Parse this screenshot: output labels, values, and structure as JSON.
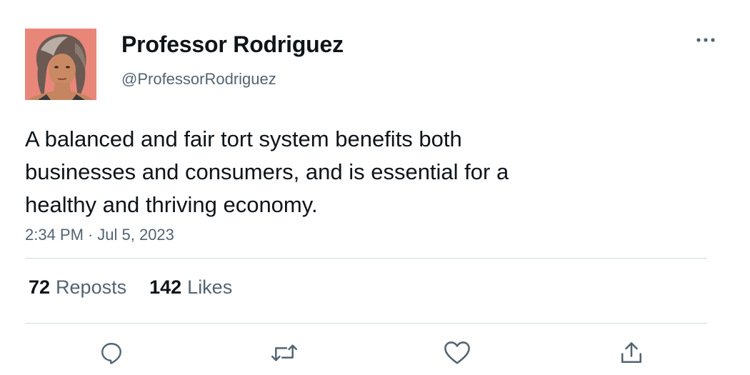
{
  "author": {
    "display_name": "Professor Rodriguez",
    "handle": "@ProfessorRodriguez"
  },
  "tweet": {
    "text": "A balanced and fair tort system benefits both\nbusinesses and consumers, and is essential for a\nhealthy and thriving economy.",
    "time": "2:34 PM",
    "separator": "·",
    "date": "Jul 5, 2023"
  },
  "stats": {
    "reposts_count": "72",
    "reposts_label": "Reposts",
    "likes_count": "142",
    "likes_label": "Likes"
  },
  "icons": {
    "more": "more-horizontal-icon",
    "reply": "reply-icon",
    "repost": "repost-icon",
    "like": "heart-icon",
    "share": "share-icon"
  },
  "colors": {
    "text_primary": "#0f1419",
    "text_secondary": "#536471",
    "divider": "#cfd9de",
    "avatar_bg": "#e9867a"
  }
}
